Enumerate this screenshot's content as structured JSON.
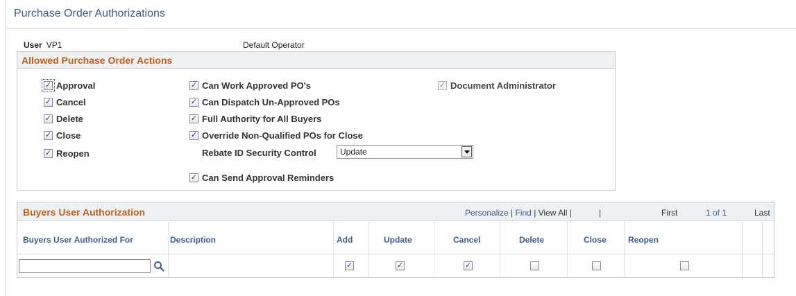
{
  "page": {
    "title": "Purchase Order Authorizations"
  },
  "user": {
    "label": "User",
    "id": "VP1",
    "description": "Default Operator"
  },
  "allowed_actions": {
    "title": "Allowed Purchase Order Actions",
    "col1": [
      {
        "label": "Approval",
        "checked": true
      },
      {
        "label": "Cancel",
        "checked": true
      },
      {
        "label": "Delete",
        "checked": true
      },
      {
        "label": "Close",
        "checked": true
      },
      {
        "label": "Reopen",
        "checked": true
      }
    ],
    "col2": [
      {
        "label": "Can Work Approved PO's",
        "checked": true
      },
      {
        "label": "Can Dispatch Un-Approved POs",
        "checked": true
      },
      {
        "label": "Full Authority for All Buyers",
        "checked": true
      },
      {
        "label": "Override Non-Qualified POs for Close",
        "checked": true
      }
    ],
    "document_admin": {
      "label": "Document Administrator",
      "checked": true,
      "disabled": true
    },
    "rebate": {
      "label": "Rebate ID Security Control",
      "value": "Update"
    },
    "reminders": {
      "label": "Can Send Approval Reminders",
      "checked": true
    }
  },
  "buyers_grid": {
    "title": "Buyers User Authorization",
    "nav": {
      "personalize": "Personalize",
      "find": "Find",
      "view_all": "View All",
      "first": "First",
      "range": "1 of 1",
      "last": "Last"
    },
    "columns": [
      "Buyers User Authorized For",
      "Description",
      "Add",
      "Update",
      "Cancel",
      "Delete",
      "Close",
      "Reopen"
    ],
    "rows": [
      {
        "buyer": "",
        "description": "",
        "add": true,
        "update": true,
        "cancel": true,
        "delete": false,
        "close": false,
        "reopen": false
      }
    ]
  }
}
